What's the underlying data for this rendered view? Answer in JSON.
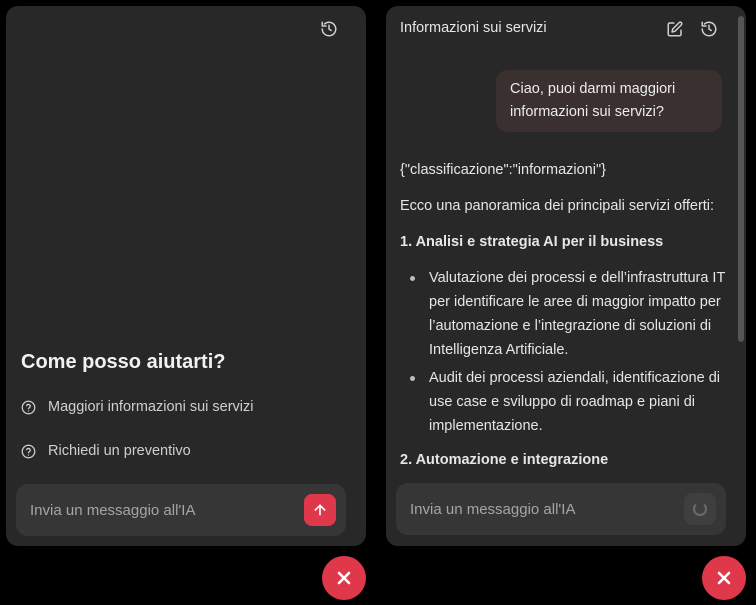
{
  "left": {
    "welcome_title": "Come posso aiutarti?",
    "suggestions": [
      {
        "label": "Maggiori informazioni sui servizi",
        "icon": "help-circle-icon"
      },
      {
        "label": "Richiedi un preventivo",
        "icon": "help-circle-icon"
      }
    ],
    "input_placeholder": "Invia un messaggio all'IA",
    "icons": {
      "history": "history-icon",
      "send": "arrow-up-icon"
    }
  },
  "right": {
    "header_title": "Informazioni sui servizi",
    "icons": {
      "edit": "edit-icon",
      "history": "history-icon"
    },
    "user_message": "Ciao, puoi darmi maggiori informazioni sui servizi?",
    "assistant": {
      "json_line": "{\"classificazione\":\"informazioni\"}",
      "intro": "Ecco una panoramica dei principali servizi offerti:",
      "section1_heading": "1. Analisi e strategia AI per il business",
      "section1_bullets": [
        "Valutazione dei processi e dell’infrastruttura IT per identificare le aree di maggior impatto per l’automazione e l’integrazione di soluzioni di Intelligenza Artificiale.",
        "Audit dei processi aziendali, identificazione di use case e sviluppo di roadmap e piani di implementazione."
      ],
      "section2_heading": "2. Automazione e integrazione"
    },
    "input_placeholder": "Invia un messaggio all'IA"
  },
  "colors": {
    "accent": "#e0384b",
    "panel": "#282828",
    "user_bubble": "#3a3030"
  }
}
